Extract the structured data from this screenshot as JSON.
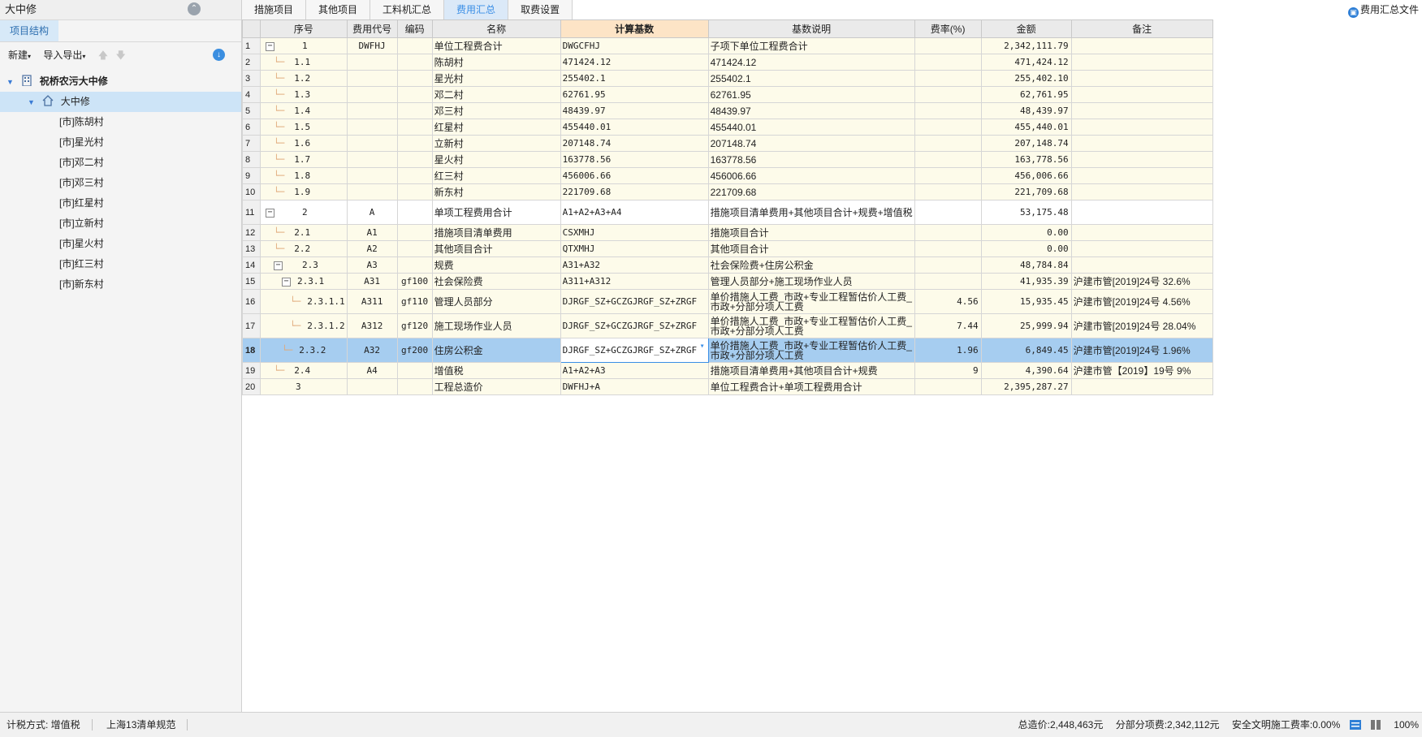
{
  "left_panel": {
    "title": "大中修",
    "tab": "项目结构",
    "toolbar": {
      "new": "新建",
      "import_export": "导入导出"
    },
    "tree": {
      "root": "祝桥农污大中修",
      "selected": "大中修",
      "children": [
        "[市]陈胡村",
        "[市]星光村",
        "[市]邓二村",
        "[市]邓三村",
        "[市]红星村",
        "[市]立新村",
        "[市]星火村",
        "[市]红三村",
        "[市]新东村"
      ]
    }
  },
  "tabs": [
    {
      "label": "措施项目",
      "active": false
    },
    {
      "label": "其他项目",
      "active": false
    },
    {
      "label": "工料机汇总",
      "active": false
    },
    {
      "label": "费用汇总",
      "active": true
    },
    {
      "label": "取费设置",
      "active": false
    }
  ],
  "top_right": "费用汇总文件",
  "grid": {
    "columns": [
      "序号",
      "费用代号",
      "编码",
      "名称",
      "计算基数",
      "基数说明",
      "费率(%)",
      "金额",
      "备注"
    ],
    "highlight_column": "计算基数",
    "rows": [
      {
        "n": "1",
        "seq": "1",
        "code": "DWFHJ",
        "bm": "",
        "name": "单位工程费合计",
        "base": "DWGCFHJ",
        "desc": "子项下单位工程费合计",
        "rate": "",
        "amount": "2,342,111.79",
        "note": ""
      },
      {
        "n": "2",
        "seq": "1.1",
        "code": "",
        "bm": "",
        "name": "陈胡村",
        "base": "471424.12",
        "desc": "471424.12",
        "rate": "",
        "amount": "471,424.12",
        "note": ""
      },
      {
        "n": "3",
        "seq": "1.2",
        "code": "",
        "bm": "",
        "name": "星光村",
        "base": "255402.1",
        "desc": "255402.1",
        "rate": "",
        "amount": "255,402.10",
        "note": ""
      },
      {
        "n": "4",
        "seq": "1.3",
        "code": "",
        "bm": "",
        "name": "邓二村",
        "base": "62761.95",
        "desc": "62761.95",
        "rate": "",
        "amount": "62,761.95",
        "note": ""
      },
      {
        "n": "5",
        "seq": "1.4",
        "code": "",
        "bm": "",
        "name": "邓三村",
        "base": "48439.97",
        "desc": "48439.97",
        "rate": "",
        "amount": "48,439.97",
        "note": ""
      },
      {
        "n": "6",
        "seq": "1.5",
        "code": "",
        "bm": "",
        "name": "红星村",
        "base": "455440.01",
        "desc": "455440.01",
        "rate": "",
        "amount": "455,440.01",
        "note": ""
      },
      {
        "n": "7",
        "seq": "1.6",
        "code": "",
        "bm": "",
        "name": "立新村",
        "base": "207148.74",
        "desc": "207148.74",
        "rate": "",
        "amount": "207,148.74",
        "note": ""
      },
      {
        "n": "8",
        "seq": "1.7",
        "code": "",
        "bm": "",
        "name": "星火村",
        "base": "163778.56",
        "desc": "163778.56",
        "rate": "",
        "amount": "163,778.56",
        "note": ""
      },
      {
        "n": "9",
        "seq": "1.8",
        "code": "",
        "bm": "",
        "name": "红三村",
        "base": "456006.66",
        "desc": "456006.66",
        "rate": "",
        "amount": "456,006.66",
        "note": ""
      },
      {
        "n": "10",
        "seq": "1.9",
        "code": "",
        "bm": "",
        "name": "新东村",
        "base": "221709.68",
        "desc": "221709.68",
        "rate": "",
        "amount": "221,709.68",
        "note": ""
      },
      {
        "n": "11",
        "seq": "2",
        "code": "A",
        "bm": "",
        "name": "单项工程费用合计",
        "base": "A1+A2+A3+A4",
        "desc": "措施项目清单费用+其他项目合计+规费+增值税",
        "rate": "",
        "amount": "53,175.48",
        "note": ""
      },
      {
        "n": "12",
        "seq": "2.1",
        "code": "A1",
        "bm": "",
        "name": "措施项目清单费用",
        "base": "CSXMHJ",
        "desc": "措施项目合计",
        "rate": "",
        "amount": "0.00",
        "note": ""
      },
      {
        "n": "13",
        "seq": "2.2",
        "code": "A2",
        "bm": "",
        "name": "其他项目合计",
        "base": "QTXMHJ",
        "desc": "其他项目合计",
        "rate": "",
        "amount": "0.00",
        "note": ""
      },
      {
        "n": "14",
        "seq": "2.3",
        "code": "A3",
        "bm": "",
        "name": "规费",
        "base": "A31+A32",
        "desc": "社会保险费+住房公积金",
        "rate": "",
        "amount": "48,784.84",
        "note": ""
      },
      {
        "n": "15",
        "seq": "2.3.1",
        "code": "A31",
        "bm": "gf100",
        "name": "社会保险费",
        "base": "A311+A312",
        "desc": "管理人员部分+施工现场作业人员",
        "rate": "",
        "amount": "41,935.39",
        "note": "沪建市管[2019]24号 32.6%"
      },
      {
        "n": "16",
        "seq": "2.3.1.1",
        "code": "A311",
        "bm": "gf110",
        "name": "管理人员部分",
        "base": "DJRGF_SZ+GCZGJRGF_SZ+ZRGF",
        "desc": "单价措施人工费_市政+专业工程暂估价人工费_市政+分部分项人工费",
        "rate": "4.56",
        "amount": "15,935.45",
        "note": "沪建市管[2019]24号 4.56%"
      },
      {
        "n": "17",
        "seq": "2.3.1.2",
        "code": "A312",
        "bm": "gf120",
        "name": "施工现场作业人员",
        "base": "DJRGF_SZ+GCZGJRGF_SZ+ZRGF",
        "desc": "单价措施人工费_市政+专业工程暂估价人工费_市政+分部分项人工费",
        "rate": "7.44",
        "amount": "25,999.94",
        "note": "沪建市管[2019]24号 28.04%"
      },
      {
        "n": "18",
        "seq": "2.3.2",
        "code": "A32",
        "bm": "gf200",
        "name": "住房公积金",
        "base": "DJRGF_SZ+GCZGJRGF_SZ+ZRGF",
        "desc": "单价措施人工费_市政+专业工程暂估价人工费_市政+分部分项人工费",
        "rate": "1.96",
        "amount": "6,849.45",
        "note": "沪建市管[2019]24号 1.96%"
      },
      {
        "n": "19",
        "seq": "2.4",
        "code": "A4",
        "bm": "",
        "name": "增值税",
        "base": "A1+A2+A3",
        "desc": "措施项目清单费用+其他项目合计+规费",
        "rate": "9",
        "amount": "4,390.64",
        "note": "沪建市管【2019】19号 9%"
      },
      {
        "n": "20",
        "seq": "3",
        "code": "",
        "bm": "",
        "name": "工程总造价",
        "base": "DWFHJ+A",
        "desc": "单位工程费合计+单项工程费用合计",
        "rate": "",
        "amount": "2,395,287.27",
        "note": ""
      }
    ]
  },
  "status": {
    "tax_mode": "计税方式: 增值税",
    "standard": "上海13清单规范",
    "total": "总造价:2,448,463元",
    "sub_total": "分部分项费:2,342,112元",
    "safety_rate": "安全文明施工费率:0.00%",
    "zoom": "100%"
  }
}
